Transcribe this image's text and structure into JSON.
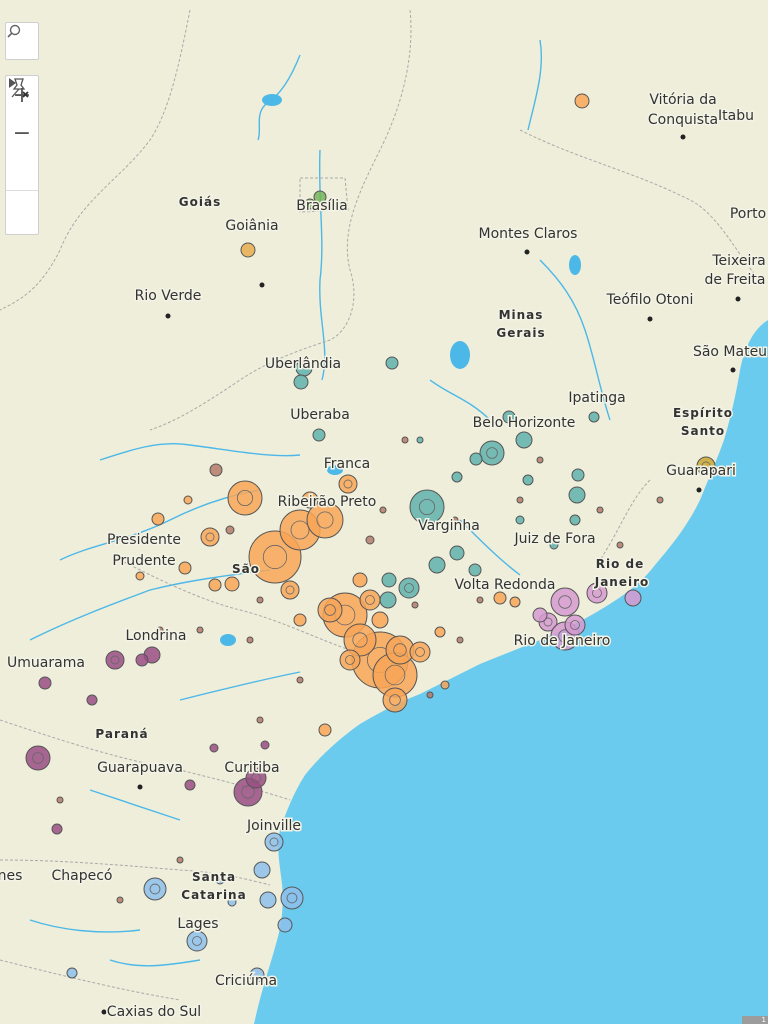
{
  "map": {
    "land_color": "#eeeedb",
    "ocean_color": "#6bcbee",
    "river_color": "#4cb8e8",
    "border_color": "#a9a9a9",
    "badge_text": "1",
    "labels": [
      {
        "key": "vitoria_conquista",
        "text": "Vitória da Conquista",
        "type": "city"
      },
      {
        "key": "itabuna",
        "text": "Itabu",
        "type": "city"
      },
      {
        "key": "goias",
        "text": "Goiás",
        "type": "state"
      },
      {
        "key": "brasilia",
        "text": "Brasília",
        "type": "city"
      },
      {
        "key": "goiania",
        "text": "Goiânia",
        "type": "city"
      },
      {
        "key": "montes_claros",
        "text": "Montes Claros",
        "type": "city"
      },
      {
        "key": "porto",
        "text": "Porto",
        "type": "city"
      },
      {
        "key": "teixeira",
        "text": "Teixeira de Freita",
        "type": "city"
      },
      {
        "key": "rio_verde",
        "text": "Rio Verde",
        "type": "city"
      },
      {
        "key": "teofilo_otoni",
        "text": "Teófilo Otoni",
        "type": "city"
      },
      {
        "key": "minas_gerais",
        "text": "Minas Gerais",
        "type": "state"
      },
      {
        "key": "sao_mateus",
        "text": "São Mateu",
        "type": "city"
      },
      {
        "key": "uberlandia",
        "text": "Uberlândia",
        "type": "city"
      },
      {
        "key": "ipatinga",
        "text": "Ipatinga",
        "type": "city"
      },
      {
        "key": "uberaba",
        "text": "Uberaba",
        "type": "city"
      },
      {
        "key": "espirito_santo",
        "text": "Espírito Santo",
        "type": "state"
      },
      {
        "key": "belo_horizonte",
        "text": "Belo Horizonte",
        "type": "city"
      },
      {
        "key": "franca",
        "text": "Franca",
        "type": "city"
      },
      {
        "key": "guarapari",
        "text": "Guarapari",
        "type": "city"
      },
      {
        "key": "ribeirao_preto",
        "text": "Ribeirão Preto",
        "type": "city"
      },
      {
        "key": "varginha",
        "text": "Varginha",
        "type": "city"
      },
      {
        "key": "presidente_prudente",
        "text": "Presidente Prudente",
        "type": "city"
      },
      {
        "key": "juiz_de_fora",
        "text": "Juiz de Fora",
        "type": "city"
      },
      {
        "key": "sao_paulo_state",
        "text": "São",
        "type": "state"
      },
      {
        "key": "rio_de_janeiro_state",
        "text": "Rio de Janeiro",
        "type": "state"
      },
      {
        "key": "volta_redonda",
        "text": "Volta Redonda",
        "type": "city"
      },
      {
        "key": "londrina",
        "text": "Londrina",
        "type": "city"
      },
      {
        "key": "rio_de_janeiro",
        "text": "Rio de Janeiro",
        "type": "city"
      },
      {
        "key": "umuarama",
        "text": "Umuarama",
        "type": "city"
      },
      {
        "key": "parana",
        "text": "Paraná",
        "type": "state"
      },
      {
        "key": "guarapuava",
        "text": "Guarapuava",
        "type": "city"
      },
      {
        "key": "curitiba",
        "text": "Curitiba",
        "type": "city"
      },
      {
        "key": "joinville",
        "text": "Joinville",
        "type": "city"
      },
      {
        "key": "chapeco",
        "text": "Chapecó",
        "type": "city"
      },
      {
        "key": "nes",
        "text": "nes",
        "type": "city"
      },
      {
        "key": "santa_catarina",
        "text": "Santa Catarina",
        "type": "state"
      },
      {
        "key": "lages",
        "text": "Lages",
        "type": "city"
      },
      {
        "key": "criciuma",
        "text": "Criciúma",
        "type": "city"
      },
      {
        "key": "caxias_do_sul",
        "text": "Caxias do Sul",
        "type": "city"
      }
    ],
    "region_colors": {
      "sp": "#f8a657",
      "mg": "#5fb2ad",
      "rj": "#d59ad0",
      "pr": "#9a4e85",
      "sc": "#8dbfea",
      "go": "#e7ad4d",
      "df": "#74b458",
      "es": "#c9a633",
      "ba": "#f8a657",
      "small": "#b57a6a"
    },
    "bubbles": [
      {
        "region": "sp",
        "rel_size": 14
      },
      {
        "region": "sp",
        "rel_size": 12
      },
      {
        "region": "sp",
        "rel_size": 11
      },
      {
        "region": "sp",
        "rel_size": 10
      },
      {
        "region": "sp",
        "rel_size": 9
      },
      {
        "region": "sp",
        "rel_size": 8
      },
      {
        "region": "sp",
        "rel_size": 7
      },
      {
        "region": "mg",
        "rel_size": 8
      },
      {
        "region": "mg",
        "rel_size": 6
      },
      {
        "region": "rj",
        "rel_size": 9
      },
      {
        "region": "rj",
        "rel_size": 7
      },
      {
        "region": "pr",
        "rel_size": 6
      },
      {
        "region": "pr",
        "rel_size": 5
      },
      {
        "region": "sc",
        "rel_size": 5
      },
      {
        "region": "sc",
        "rel_size": 4
      },
      {
        "region": "go",
        "rel_size": 2
      },
      {
        "region": "df",
        "rel_size": 3
      },
      {
        "region": "es",
        "rel_size": 3
      },
      {
        "region": "ba",
        "rel_size": 2
      }
    ]
  },
  "controls": {
    "search_icon": "search-icon",
    "zoom_in": "+",
    "zoom_out": "−",
    "pin_icon": "unpin-icon",
    "expand_icon": "play-arrow-icon"
  }
}
